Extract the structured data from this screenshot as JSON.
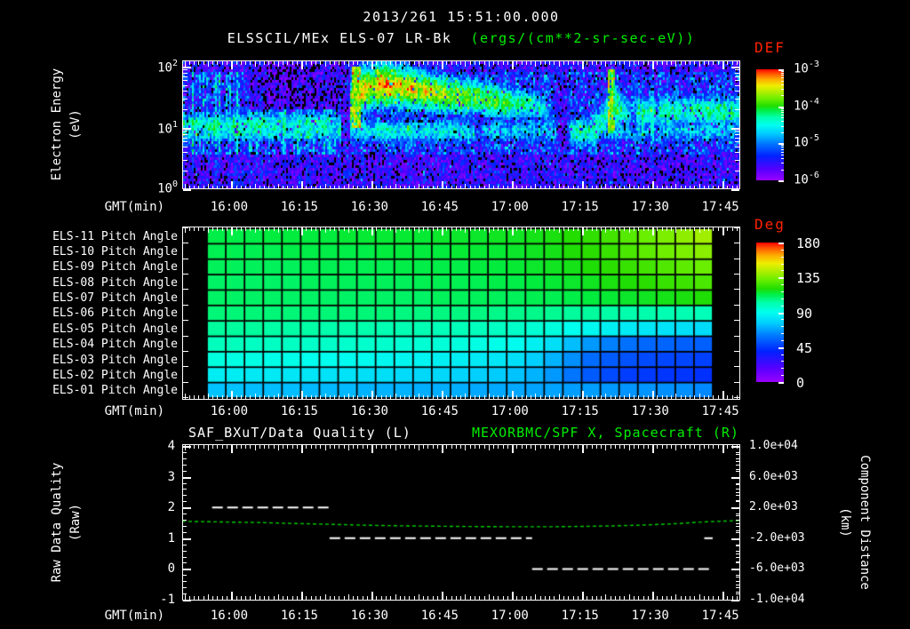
{
  "colors": {
    "background": "#000000",
    "text": "#ffffff",
    "accent_green": "#00ee00",
    "accent_red": "#ff2200",
    "line_white": "#ffffff",
    "line_green": "#00cc00"
  },
  "header": {
    "datetime": "2013/261 15:51:00.000",
    "instrument": "ELSSCIL/MEx ELS-07 LR-Bk",
    "units": "(ergs/(cm**2-sr-sec-eV))"
  },
  "time_axis": {
    "label": "GMT(min)",
    "tick_labels": [
      "16:00",
      "16:15",
      "16:30",
      "16:45",
      "17:00",
      "17:15",
      "17:30",
      "17:45"
    ],
    "tick_start_min": 10.06,
    "tick_step_min": 15,
    "axis_start_min": 0,
    "axis_end_min": 119.3
  },
  "spectrogram_panel": {
    "ylabel": [
      "Electron Energy",
      "(eV)"
    ],
    "ytick_exponents": [
      "2",
      "1",
      "0"
    ],
    "colorbar": {
      "title": "DEF",
      "tick_exponents": [
        "-3",
        "-4",
        "-5",
        "-6"
      ]
    }
  },
  "pitch_panel": {
    "colorbar": {
      "title": "Deg",
      "ticks": [
        "180",
        "135",
        "90",
        "45",
        "0"
      ]
    }
  },
  "quality_panel": {
    "title_left": "SAF_BXuT/Data Quality (L)",
    "title_right": "MEXORBMC/SPF X, Spacecraft (R)",
    "ylabel_left": [
      "Raw Data Quality",
      "(Raw)"
    ],
    "ylabel_right": [
      "Component Distance",
      "(km)"
    ],
    "yticks_left": [
      "4",
      "3",
      "2",
      "1",
      "0",
      "-1"
    ],
    "ytick_labels_right": [
      "1.0e+04",
      "6.0e+03",
      "2.0e+03",
      "-2.0e+03",
      "-6.0e+03",
      "-1.0e+04"
    ]
  },
  "chart_data": [
    {
      "type": "heatmap",
      "name": "electron-energy-spectrogram",
      "title": "ELSSCIL/MEx ELS-07 LR-Bk",
      "z_units": "ergs/(cm**2-sr-sec-eV)",
      "xlabel": "GMT(min)",
      "ylabel": "Electron Energy (eV)",
      "x_start_gmt": "15:50",
      "x_end_gmt": "17:49",
      "y_log10_ev_range": [
        0,
        2.1
      ],
      "z_log10_range": [
        -6,
        -3
      ],
      "background_v": -6.35,
      "haze": {
        "e_range": [
          0.55,
          1.92
        ],
        "v": -5.35
      },
      "low_band": {
        "e_center": 0.95,
        "e_sigma": 0.22,
        "v": -4.55
      },
      "band_keyframes": [
        [
          0,
          1.02,
          0.25,
          -4.35
        ],
        [
          14,
          1.05,
          0.25,
          -4.4
        ],
        [
          30,
          1.05,
          0.26,
          -4.45
        ],
        [
          34,
          1.05,
          0.26,
          -4.7
        ],
        [
          36,
          1.35,
          0.34,
          -3.75
        ],
        [
          38,
          1.6,
          0.32,
          -3.55
        ],
        [
          42,
          1.72,
          0.28,
          -3.4
        ],
        [
          48,
          1.66,
          0.28,
          -3.5
        ],
        [
          55,
          1.56,
          0.28,
          -3.75
        ],
        [
          62,
          1.5,
          0.28,
          -3.95
        ],
        [
          70,
          1.42,
          0.28,
          -4.15
        ],
        [
          76,
          1.36,
          0.26,
          -4.45
        ],
        [
          78,
          1.3,
          0.28,
          -4.8
        ],
        [
          80.5,
          1.2,
          0.3,
          -5.4
        ],
        [
          83.5,
          0.92,
          0.28,
          -4.35
        ],
        [
          88,
          0.95,
          0.3,
          -4.35
        ],
        [
          90.5,
          1.15,
          0.35,
          -4.3
        ],
        [
          92,
          1.45,
          0.42,
          -3.8
        ],
        [
          93.5,
          1.3,
          0.32,
          -4.3
        ],
        [
          96,
          1.2,
          0.3,
          -4.6
        ],
        [
          98,
          1.25,
          0.3,
          -4.35
        ],
        [
          104,
          1.28,
          0.3,
          -4.3
        ],
        [
          110,
          1.28,
          0.3,
          -4.4
        ],
        [
          119.3,
          1.25,
          0.3,
          -4.35
        ]
      ],
      "blob": {
        "t_center": 45,
        "t_sigma": 5.5,
        "e_center": 1.7,
        "e_sigma": 0.16,
        "v": -3.2
      },
      "streaks": [
        {
          "t": [
            36.2,
            38
          ],
          "e": [
            1.0,
            2.02
          ],
          "v": -3.6
        },
        {
          "t": [
            91,
            92.8
          ],
          "e": [
            0.9,
            1.98
          ],
          "v": -3.85
        }
      ],
      "dark_regions": [
        {
          "t": [
            14,
            34
          ],
          "e": [
            1.32,
            2.1
          ],
          "v": -5.75
        },
        {
          "t": [
            33.8,
            35.8
          ],
          "e": [
            0.5,
            2.1
          ],
          "v": -5.6
        },
        {
          "t": [
            80,
            82.8
          ],
          "e": [
            0.4,
            1.95
          ],
          "v": -5.55
        },
        {
          "t": [
            62.5,
            64.2
          ],
          "e": [
            0.35,
            1.25
          ],
          "v": -5.4
        },
        {
          "t": [
            96.2,
            97.2
          ],
          "e": [
            0.5,
            1.6
          ],
          "v": -5.2
        },
        {
          "t": [
            101.2,
            102.2
          ],
          "e": [
            0.5,
            1.6
          ],
          "v": -5.1
        }
      ]
    },
    {
      "type": "heatmap",
      "name": "pitch-angle-grid",
      "z_units": "Deg",
      "z_range": [
        0,
        180
      ],
      "columns": 27,
      "rows": [
        {
          "label": "ELS-11 Pitch Angle",
          "values": [
            113,
            113,
            113,
            114,
            114,
            114,
            114,
            115,
            115,
            115,
            115,
            115,
            116,
            116,
            116,
            117,
            117,
            118,
            119,
            121,
            123,
            126,
            129,
            132,
            135,
            138,
            141
          ]
        },
        {
          "label": "ELS-10 Pitch Angle",
          "values": [
            112,
            112,
            112,
            112,
            113,
            113,
            113,
            113,
            113,
            114,
            114,
            114,
            114,
            115,
            115,
            115,
            116,
            117,
            118,
            120,
            122,
            124,
            127,
            130,
            133,
            135,
            137
          ]
        },
        {
          "label": "ELS-09 Pitch Angle",
          "values": [
            111,
            111,
            111,
            111,
            111,
            112,
            112,
            112,
            112,
            112,
            113,
            113,
            113,
            113,
            114,
            114,
            115,
            116,
            117,
            118,
            120,
            122,
            124,
            126,
            128,
            130,
            132
          ]
        },
        {
          "label": "ELS-08 Pitch Angle",
          "values": [
            110,
            110,
            110,
            110,
            110,
            111,
            111,
            111,
            111,
            111,
            111,
            112,
            112,
            112,
            112,
            113,
            113,
            114,
            115,
            116,
            117,
            119,
            120,
            122,
            124,
            125,
            127
          ]
        },
        {
          "label": "ELS-07 Pitch Angle",
          "values": [
            110,
            110,
            110,
            110,
            110,
            110,
            110,
            110,
            110,
            110,
            110,
            110,
            111,
            111,
            111,
            111,
            111,
            112,
            112,
            113,
            114,
            115,
            116,
            117,
            118,
            119,
            120
          ]
        },
        {
          "label": "ELS-06 Pitch Angle",
          "values": [
            108,
            108,
            108,
            108,
            108,
            108,
            108,
            108,
            108,
            108,
            107,
            107,
            107,
            107,
            107,
            106,
            106,
            106,
            105,
            104,
            104,
            103,
            102,
            102,
            101,
            101,
            100
          ]
        },
        {
          "label": "ELS-05 Pitch Angle",
          "values": [
            104,
            104,
            104,
            103,
            103,
            103,
            102,
            102,
            102,
            101,
            101,
            101,
            100,
            100,
            99,
            98,
            97,
            95,
            93,
            90,
            88,
            86,
            84,
            83,
            82,
            81,
            80
          ]
        },
        {
          "label": "ELS-04 Pitch Angle",
          "values": [
            99,
            99,
            98,
            98,
            98,
            97,
            97,
            96,
            96,
            96,
            95,
            95,
            94,
            93,
            92,
            91,
            89,
            86,
            81,
            73,
            66,
            61,
            58,
            56,
            55,
            54,
            54
          ]
        },
        {
          "label": "ELS-03 Pitch Angle",
          "values": [
            93,
            92,
            92,
            91,
            91,
            90,
            90,
            89,
            89,
            88,
            88,
            87,
            86,
            85,
            84,
            83,
            81,
            77,
            71,
            64,
            57,
            53,
            51,
            49,
            48,
            48,
            47
          ]
        },
        {
          "label": "ELS-02 Pitch Angle",
          "values": [
            85,
            85,
            84,
            84,
            83,
            83,
            82,
            82,
            81,
            81,
            80,
            79,
            79,
            78,
            77,
            76,
            74,
            71,
            66,
            59,
            53,
            49,
            46,
            45,
            44,
            44,
            43
          ]
        },
        {
          "label": "ELS-01 Pitch Angle",
          "values": [
            74,
            74,
            73,
            73,
            73,
            72,
            72,
            72,
            71,
            71,
            71,
            70,
            70,
            70,
            69,
            69,
            69,
            68,
            68,
            67,
            67,
            66,
            65,
            65,
            64,
            64,
            63
          ]
        }
      ]
    },
    {
      "type": "line",
      "name": "quality-and-distance",
      "ylim_left": [
        -1,
        4
      ],
      "ylim_right": [
        -10000,
        10000
      ],
      "series": [
        {
          "name": "SAF_BXuT/Data Quality (L)",
          "style": "dashed-white",
          "segments": [
            {
              "value": 2,
              "t_start": 6.4,
              "t_end": 31.5
            },
            {
              "value": 1,
              "t_start": 31.5,
              "t_end": 74.8
            },
            {
              "value": 0,
              "t_start": 74.8,
              "t_end": 112.6
            },
            {
              "value": 1,
              "t_start": 111.6,
              "t_end": 113.4
            }
          ]
        },
        {
          "name": "MEXORBMC/SPF X, Spacecraft (R)",
          "style": "dashed-green",
          "points_t_km": [
            [
              0,
              200
            ],
            [
              8,
              120
            ],
            [
              16,
              40
            ],
            [
              24,
              -80
            ],
            [
              32,
              -200
            ],
            [
              40,
              -320
            ],
            [
              48,
              -400
            ],
            [
              56,
              -450
            ],
            [
              64,
              -490
            ],
            [
              72,
              -510
            ],
            [
              80,
              -500
            ],
            [
              86,
              -460
            ],
            [
              92,
              -400
            ],
            [
              98,
              -300
            ],
            [
              103,
              -180
            ],
            [
              107,
              -60
            ],
            [
              110,
              60
            ],
            [
              113,
              160
            ],
            [
              116,
              230
            ],
            [
              119,
              280
            ]
          ]
        }
      ]
    }
  ]
}
